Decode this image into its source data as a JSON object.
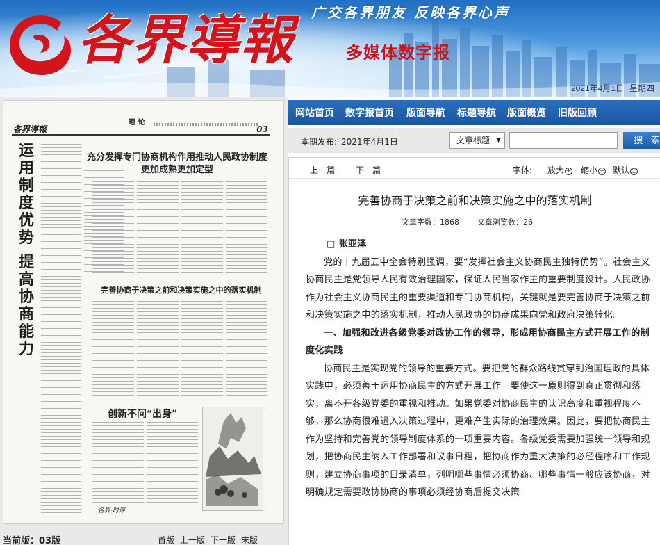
{
  "banner": {
    "masthead": "各界導報",
    "slogan": "广交各界朋友 反映各界心声",
    "subhead": "多媒体数字报",
    "date": "2021年4月1日",
    "weekday": "星期四"
  },
  "paper": {
    "brand": "各界導報",
    "section": "理 论",
    "page_no": "03",
    "vertical_title_a": "运用制度优势",
    "vertical_title_b": "提高协商能力",
    "headline_1": "充分发挥专门协商机构作用推动人民政协制度更加成熟更加定型",
    "headline_2": "完善协商于决策之前和决策实施之中的落实机制",
    "headline_3": "创新不问“出身”",
    "stamp": "各界·时评"
  },
  "footer": {
    "current_page_label": "当前版：03版",
    "first": "首版",
    "prev": "上一版",
    "next": "下一版",
    "last": "末版"
  },
  "nav": {
    "items": [
      "网站首页",
      "数字报首页",
      "版面导航",
      "标题导航",
      "版面概览",
      "旧版回顾"
    ]
  },
  "search": {
    "issue_label": "本期发布:",
    "issue_date": "2021年4月1日",
    "select_value": "文章标题",
    "input_value": "",
    "button_label": "搜 索"
  },
  "toolbar": {
    "prev_article": "上一篇",
    "next_article": "下一篇",
    "font_label": "字体:",
    "enlarge": "放大",
    "shrink": "缩小",
    "default": "默认"
  },
  "article": {
    "title": "完善协商于决策之前和决策实施之中的落实机制",
    "word_count": "文章字数：1868",
    "view_count": "文章浏览数：26",
    "author": "□ 张亚泽",
    "p1": "党的十九届五中全会特别强调，要“发挥社会主义协商民主独特优势”。社会主义协商民主是党领导人民有效治理国家，保证人民当家作主的重要制度设计。人民政协作为社会主义协商民主的重要渠道和专门协商机构，关键就是要完善协商于决策之前和决策实施之中的落实机制，推动人民政协的协商成果向党和政府决策转化。",
    "h1": "一、加强和改进各级党委对政协工作的领导，形成用协商民主方式开展工作的制度化实践",
    "p2": "协商民主是实现党的领导的重要方式。要把党的群众路线贯穿到治国理政的具体实践中，必须善于运用协商民主的方式开展工作。要使这一原则得到真正贯彻和落实，离不开各级党委的重视和推动。如果党委对协商民主的认识高度和重视程度不够，那么协商很难进入决策过程中，更难产生实际的治理效果。因此，要把协商民主作为坚持和完善党的领导制度体系的一项重要内容。各级党委需要加强统一领导和规划，把协商民主纳入工作部署和议事日程，把协商作为重大决策的必经程序和工作规则，建立协商事项的目录清单，列明哪些事情必须协商、哪些事情一般应该协商，对明确规定需要政协协商的事项必须经协商后提交决策"
  }
}
